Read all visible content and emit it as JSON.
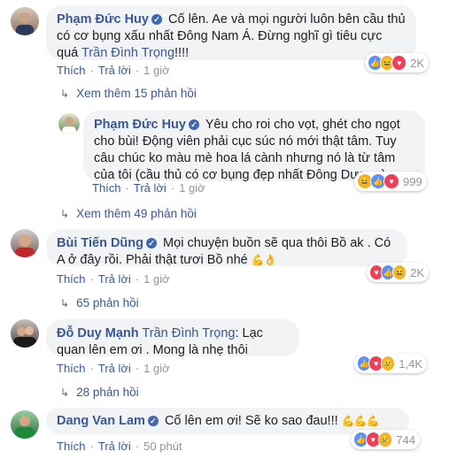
{
  "comments": [
    {
      "name": "Phạm Đức Huy",
      "text": "Cố lên. Ae và mọi người luôn bên cầu thủ có cơ bụng xấu nhất Đông Nam Á. Đừng nghĩ gì tiêu cực quá",
      "tag": "Trần Đình Trọng",
      "tail": "!!!!",
      "like": "Thích",
      "reply": "Trả lời",
      "time": "1 giờ",
      "reaction_count": "2K",
      "reactions": [
        "like-icon",
        "haha-icon",
        "love-icon"
      ]
    },
    {
      "more": "Xem thêm 15 phản hồi"
    },
    {
      "name": "Phạm Đức Huy",
      "text": "Yêu cho roi cho vọt, ghét cho ngọt cho bùi! Động viên phải cục súc nó mới thật tâm. Tuy câu chúc ko màu mè hoa lá cành nhưng nó là từ tâm của tôi (cầu thủ có cơ bụng đẹp nhất Đông Dương)",
      "like": "Thích",
      "reply": "Trả lời",
      "time": "1 giờ",
      "reaction_count": "999",
      "reactions": [
        "haha-icon",
        "like-icon",
        "love-icon"
      ]
    },
    {
      "more": "Xem thêm 49 phản hồi"
    },
    {
      "name": "Bùi Tiến Dũng",
      "text": "Mọi chuyện buồn sẽ qua thôi Bồ ak . Có A ở đây rồi. Phải thật tươi Bồ nhé",
      "emoji": "💪👌",
      "like": "Thích",
      "reply": "Trả lời",
      "time": "1 giờ",
      "reaction_count": "2K",
      "reactions": [
        "love-icon",
        "like-icon",
        "haha-icon"
      ]
    },
    {
      "more": "65 phản hồi"
    },
    {
      "name": "Đỗ Duy Mạnh",
      "tag": "Trần Đình Trọng",
      "text": ": Lạc quan lên em ơi . Mong là nhẹ thôi",
      "like": "Thích",
      "reply": "Trả lời",
      "time": "1 giờ",
      "reaction_count": "1,4K",
      "reactions": [
        "like-icon",
        "love-icon",
        "sad-icon"
      ]
    },
    {
      "more": "28 phản hồi"
    },
    {
      "name": "Dang Van Lam",
      "text": "Cố lên em ơi! Sẽ ko sao đau!!!",
      "emoji": "💪💪💪",
      "like": "Thích",
      "reply": "Trả lời",
      "time": "50 phút",
      "reaction_count": "744",
      "reactions": [
        "like-icon",
        "love-icon",
        "sad-icon"
      ]
    }
  ]
}
